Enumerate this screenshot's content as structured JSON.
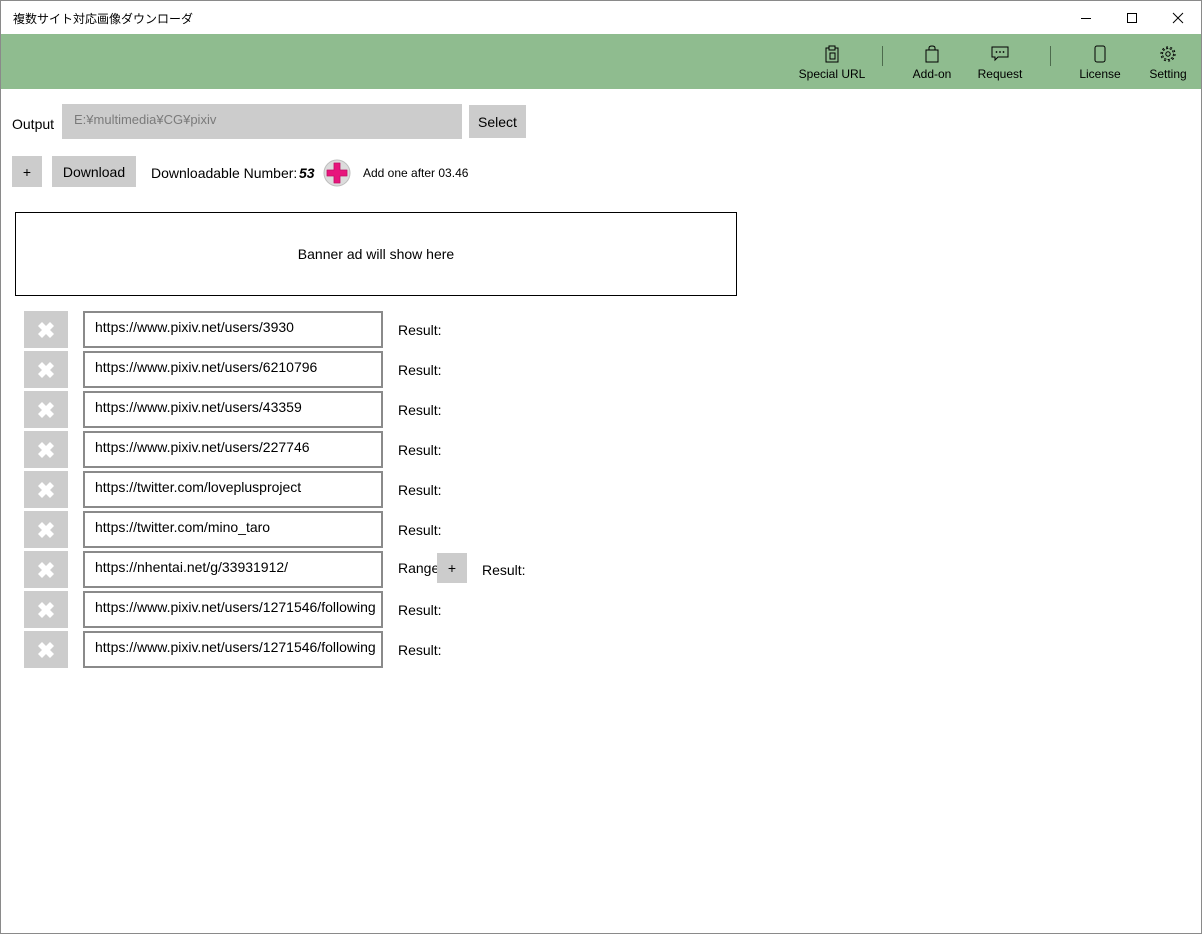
{
  "window": {
    "title": "複数サイト対応画像ダウンローダ"
  },
  "commandbar": {
    "items": [
      {
        "label": "Special URL",
        "icon": "clipboard-icon"
      },
      {
        "label": "Add-on",
        "icon": "shopping-bag-icon"
      },
      {
        "label": "Request",
        "icon": "chat-icon"
      },
      {
        "label": "License",
        "icon": "phone-icon"
      },
      {
        "label": "Setting",
        "icon": "gear-icon"
      }
    ]
  },
  "output": {
    "label": "Output",
    "path": "E:¥multimedia¥CG¥pixiv",
    "select_label": "Select"
  },
  "toolbar": {
    "plus_label": "+",
    "download_label": "Download",
    "downloadable_label": "Downloadable Number:",
    "downloadable_value": "53",
    "add_one_text": "Add one after 03.46"
  },
  "banner": {
    "text": "Banner ad will show here"
  },
  "urls": [
    {
      "url": "https://www.pixiv.net/users/3930",
      "result_label": "Result:"
    },
    {
      "url": "https://www.pixiv.net/users/6210796",
      "result_label": "Result:"
    },
    {
      "url": "https://www.pixiv.net/users/43359",
      "result_label": "Result:"
    },
    {
      "url": "https://www.pixiv.net/users/227746",
      "result_label": "Result:"
    },
    {
      "url": "https://twitter.com/loveplusproject",
      "result_label": "Result:"
    },
    {
      "url": "https://twitter.com/mino_taro",
      "result_label": "Result:"
    },
    {
      "url": "https://nhentai.net/g/33931912/",
      "result_label": "Result:",
      "range_label": "Range",
      "range_plus": "+"
    },
    {
      "url": "https://www.pixiv.net/users/1271546/following",
      "result_label": "Result:"
    },
    {
      "url": "https://www.pixiv.net/users/1271546/following",
      "result_label": "Result:"
    }
  ],
  "colors": {
    "commandbar_bg": "#8fbc8f",
    "button_gray": "#cccccc",
    "plus_accent": "#e8157c"
  }
}
